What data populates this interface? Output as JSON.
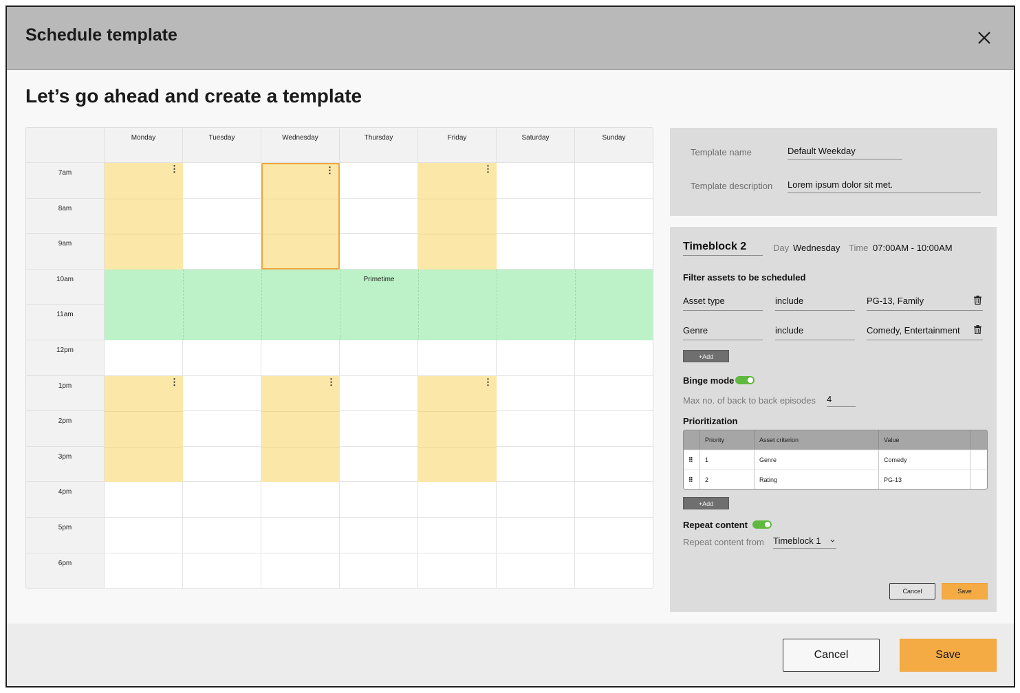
{
  "modal": {
    "title": "Schedule template",
    "close_icon": "close-icon"
  },
  "page": {
    "heading": "Let’s go ahead and create a template"
  },
  "calendar": {
    "days": [
      "Monday",
      "Tuesday",
      "Wednesday",
      "Thursday",
      "Friday",
      "Saturday",
      "Sunday"
    ],
    "times": [
      "7am",
      "8am",
      "9am",
      "10am",
      "11am",
      "12pm",
      "1pm",
      "2pm",
      "3pm",
      "4pm",
      "5pm",
      "6pm"
    ],
    "primetime_label": "Primetime",
    "colors": {
      "timeblock": "#fbe7a8",
      "selected_border": "#f0a63e",
      "primetime": "#bdf2c8"
    }
  },
  "template": {
    "name_label": "Template name",
    "name_value": "Default Weekday",
    "description_label": "Template description",
    "description_value": "Lorem ipsum dolor sit met."
  },
  "timeblock": {
    "title": "Timeblock 2",
    "day_label": "Day",
    "day_value": "Wednesday",
    "time_label": "Time",
    "time_value": "07:00AM - 10:00AM",
    "filter_title": "Filter assets to be scheduled",
    "filters": [
      {
        "field": "Asset type",
        "operator": "include",
        "value": "PG-13, Family"
      },
      {
        "field": "Genre",
        "operator": "include",
        "value": "Comedy, Entertainment"
      }
    ],
    "add_label": "+Add",
    "binge_label": "Binge mode",
    "max_episodes_label": "Max no. of back to back episodes",
    "max_episodes_value": "4",
    "prioritization_title": "Prioritization",
    "prio_headers": [
      "Priority",
      "Asset criterion",
      "Value"
    ],
    "prio_rows": [
      {
        "handle": "⠿",
        "priority": "1",
        "criterion": "Genre",
        "value": "Comedy"
      },
      {
        "handle": "⠿",
        "priority": "2",
        "criterion": "Rating",
        "value": "PG-13"
      }
    ],
    "repeat_label": "Repeat content",
    "repeat_from_label": "Repeat content from",
    "repeat_from_value": "Timeblock 1",
    "cancel_label": "Cancel",
    "save_label": "Save"
  },
  "footer": {
    "cancel_label": "Cancel",
    "save_label": "Save"
  }
}
